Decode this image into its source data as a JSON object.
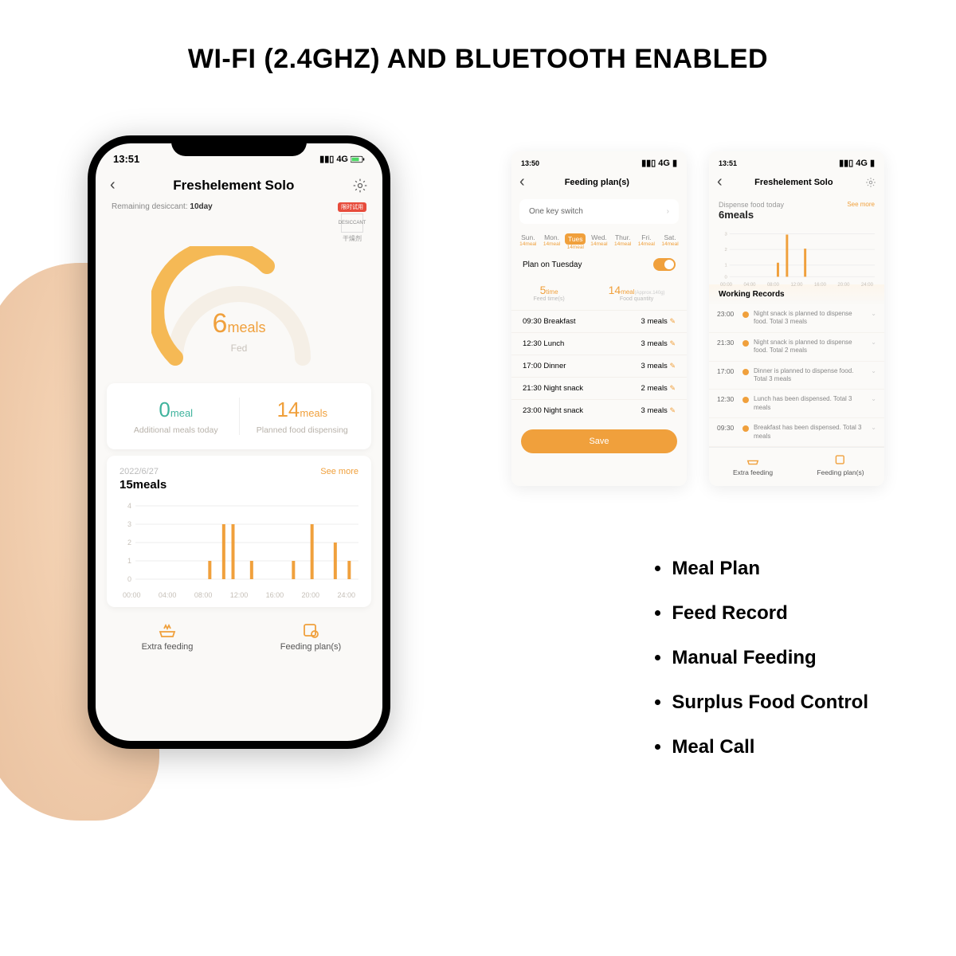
{
  "headline": "WI-FI (2.4GHZ) AND BLUETOOTH ENABLED",
  "bullets": [
    "Meal Plan",
    "Feed Record",
    "Manual Feeding",
    "Surplus Food Control",
    "Meal Call"
  ],
  "main_phone": {
    "time": "13:51",
    "signal": "4G",
    "title": "Freshelement Solo",
    "desiccant_label": "Remaining desiccant:",
    "desiccant_value": "10day",
    "desiccant_badge_red": "限时试用",
    "desiccant_badge_box": "DESICCANT",
    "desiccant_badge_cn": "干燥剂",
    "gauge_value": "6",
    "gauge_unit": "meals",
    "gauge_sub": "Fed",
    "stat_left_value": "0",
    "stat_left_unit": "meal",
    "stat_left_label": "Additional meals today",
    "stat_right_value": "14",
    "stat_right_unit": "meals",
    "stat_right_label": "Planned food dispensing",
    "chart_date": "2022/6/27",
    "chart_more": "See more",
    "chart_title": "15meals",
    "nav_extra": "Extra feeding",
    "nav_plan": "Feeding plan(s)"
  },
  "mini1": {
    "time": "13:50",
    "signal": "4G",
    "title": "Feeding plan(s)",
    "one_key": "One key switch",
    "days": [
      "Sun.",
      "Mon.",
      "Tues",
      "Wed.",
      "Thur.",
      "Fri.",
      "Sat."
    ],
    "day_sub": "14meal",
    "day_sub_alt": "14meal",
    "plan_label": "Plan on Tuesday",
    "summary_time_n": "5",
    "summary_time_u": "time",
    "summary_time_l": "Feed time(s)",
    "summary_qty_n": "14",
    "summary_qty_u": "meal",
    "summary_qty_extra": "(Approx.140g)",
    "summary_qty_l": "Food quantity",
    "meals": [
      {
        "time": "09:30",
        "name": "Breakfast",
        "qty": "3 meals"
      },
      {
        "time": "12:30",
        "name": "Lunch",
        "qty": "3 meals"
      },
      {
        "time": "17:00",
        "name": "Dinner",
        "qty": "3 meals"
      },
      {
        "time": "21:30",
        "name": "Night snack",
        "qty": "2 meals"
      },
      {
        "time": "23:00",
        "name": "Night snack",
        "qty": "3 meals"
      }
    ],
    "save": "Save"
  },
  "mini2": {
    "time": "13:51",
    "signal": "4G",
    "title": "Freshelement Solo",
    "dispense_label": "Dispense food today",
    "dispense_value": "6meals",
    "see_more": "See more",
    "records_head": "Working Records",
    "records": [
      {
        "t": "23:00",
        "txt": "Night snack is planned to dispense food. Total 3 meals"
      },
      {
        "t": "21:30",
        "txt": "Night snack is planned to dispense food. Total 2 meals"
      },
      {
        "t": "17:00",
        "txt": "Dinner is planned to dispense food. Total 3 meals"
      },
      {
        "t": "12:30",
        "txt": "Lunch has been dispensed. Total 3 meals"
      },
      {
        "t": "09:30",
        "txt": "Breakfast has been dispensed. Total 3 meals"
      }
    ],
    "nav_extra": "Extra feeding",
    "nav_plan": "Feeding plan(s)"
  },
  "chart_data": {
    "type": "bar",
    "title": "15meals",
    "xlabel": "",
    "ylabel": "",
    "ylim": [
      0,
      4
    ],
    "x_ticks": [
      "00:00",
      "04:00",
      "08:00",
      "12:00",
      "16:00",
      "20:00",
      "24:00"
    ],
    "values": [
      {
        "x": "08:00",
        "y": 1
      },
      {
        "x": "09:30",
        "y": 3
      },
      {
        "x": "10:30",
        "y": 3
      },
      {
        "x": "12:30",
        "y": 1
      },
      {
        "x": "17:00",
        "y": 1
      },
      {
        "x": "19:00",
        "y": 3
      },
      {
        "x": "21:30",
        "y": 2
      },
      {
        "x": "23:00",
        "y": 1
      }
    ]
  },
  "mini2_chart": {
    "type": "bar",
    "ylim": [
      0,
      3
    ],
    "x_ticks": [
      "00:00",
      "04:00",
      "08:00",
      "12:00",
      "16:00",
      "20:00",
      "24:00"
    ],
    "values": [
      {
        "x": "08:00",
        "y": 1
      },
      {
        "x": "09:30",
        "y": 3
      },
      {
        "x": "12:30",
        "y": 2
      }
    ]
  }
}
